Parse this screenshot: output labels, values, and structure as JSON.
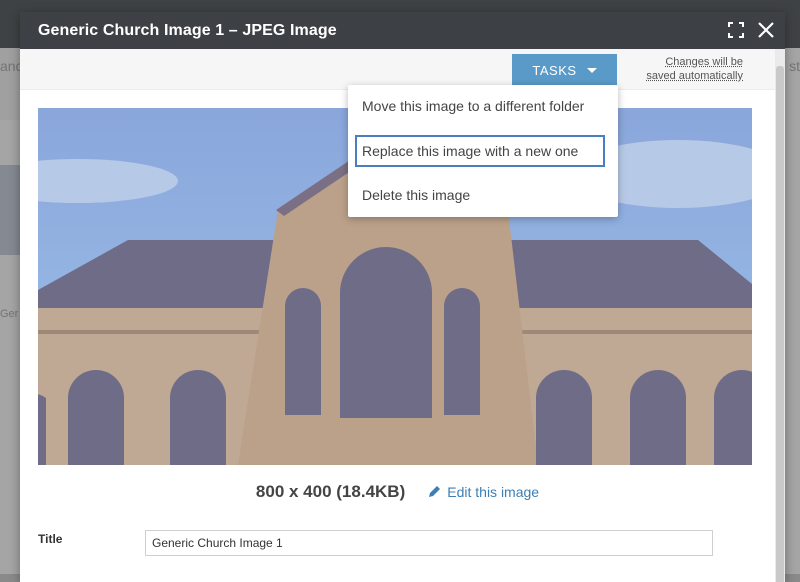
{
  "background": {
    "left_text": "and",
    "right_text": "st",
    "left_caption": "Ger"
  },
  "dialog": {
    "title": "Generic Church Image 1 – JPEG Image",
    "maximize_icon": "maximize-icon",
    "close_icon": "close-icon"
  },
  "toolbar": {
    "tasks_label": "TASKS",
    "autosave_line1": "Changes will be",
    "autosave_line2": "saved automatically"
  },
  "tasks_menu": {
    "items": [
      {
        "label": "Move this image to a different folder",
        "focused": false
      },
      {
        "label": "Replace this image with a new one",
        "focused": true
      },
      {
        "label": "Delete this image",
        "focused": false
      }
    ]
  },
  "image": {
    "dimensions": "800 x 400 (18.4KB)",
    "edit_label": "Edit this image"
  },
  "fields": {
    "title_label": "Title",
    "title_value": "Generic Church Image 1"
  },
  "colors": {
    "header_bg": "#3d4146",
    "accent": "#5a9ac8",
    "link": "#3d7fb5",
    "focus_border": "#4a7fbf"
  }
}
